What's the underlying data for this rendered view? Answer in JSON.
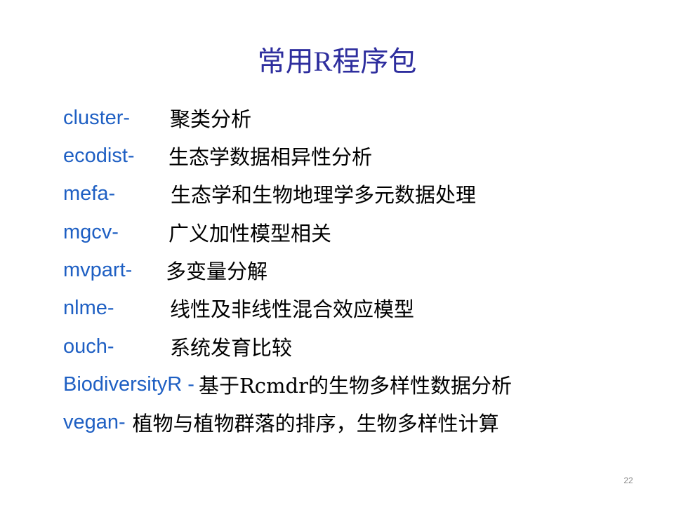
{
  "slide": {
    "title_prefix": "常用",
    "title_latin": "R",
    "title_suffix": "程序包",
    "page_number": "22"
  },
  "packages": [
    {
      "name": "cluster-",
      "description": "聚类分析"
    },
    {
      "name": "ecodist-",
      "description": "生态学数据相异性分析"
    },
    {
      "name": "mefa-",
      "description": "生态学和生物地理学多元数据处理"
    },
    {
      "name": "mgcv-",
      "description": "广义加性模型相关"
    },
    {
      "name": "mvpart-",
      "description": "多变量分解"
    },
    {
      "name": "nlme-",
      "description": "线性及非线性混合效应模型"
    },
    {
      "name": "ouch-",
      "description": "系统发育比较"
    },
    {
      "name": "BiodiversityR -",
      "description": "基于Rcmdr的生物多样性数据分析"
    },
    {
      "name": "vegan-",
      "description": "植物与植物群落的排序，生物多样性计算"
    }
  ]
}
